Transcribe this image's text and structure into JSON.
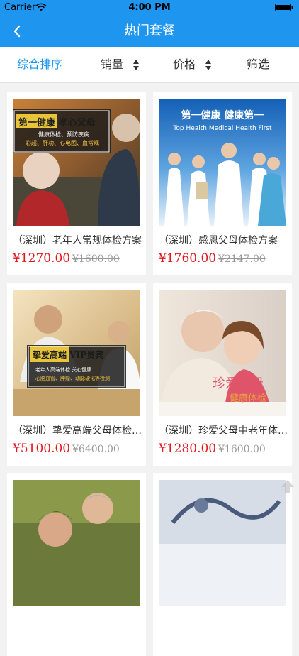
{
  "status": {
    "carrier": "Carrier",
    "time": "4:00 PM"
  },
  "nav": {
    "title": "热门套餐"
  },
  "sort": {
    "items": [
      {
        "label": "综合排序",
        "active": true
      },
      {
        "label": "销量"
      },
      {
        "label": "价格"
      },
      {
        "label": "筛选"
      }
    ]
  },
  "products": [
    {
      "name": "（深圳）老年人常规体检方案",
      "price": "¥1270.00",
      "original_price": "¥1600.00",
      "image_caption": "第一健康  孝心父母",
      "image_subcaption": "健康体检、预防疾病",
      "image_tags": "彩超、肝功、心电图、血常规"
    },
    {
      "name": "（深圳）感恩父母体检方案",
      "price": "¥1760.00",
      "original_price": "¥2147.00",
      "image_caption": "第一健康  健康第一",
      "image_subcaption": "Top Health Medical  Health First"
    },
    {
      "name": "（深圳）挚爱高端父母体检…",
      "price": "¥5100.00",
      "original_price": "¥6400.00",
      "image_caption": "挚爱高端  VIP贵宾",
      "image_subcaption": "老年人高端体检  关心健康",
      "image_tags": "心脑血管、肿瘤、动脉硬化等检测"
    },
    {
      "name": "（深圳）珍爱父母中老年体…",
      "price": "¥1280.00",
      "original_price": "¥1600.00",
      "image_caption": "珍爱父母",
      "image_subcaption": "健康体检"
    },
    {
      "name": "",
      "price": "",
      "original_price": ""
    },
    {
      "name": "",
      "price": "",
      "original_price": ""
    }
  ],
  "colors": {
    "primary": "#1e96f0",
    "price": "#e0161c"
  }
}
